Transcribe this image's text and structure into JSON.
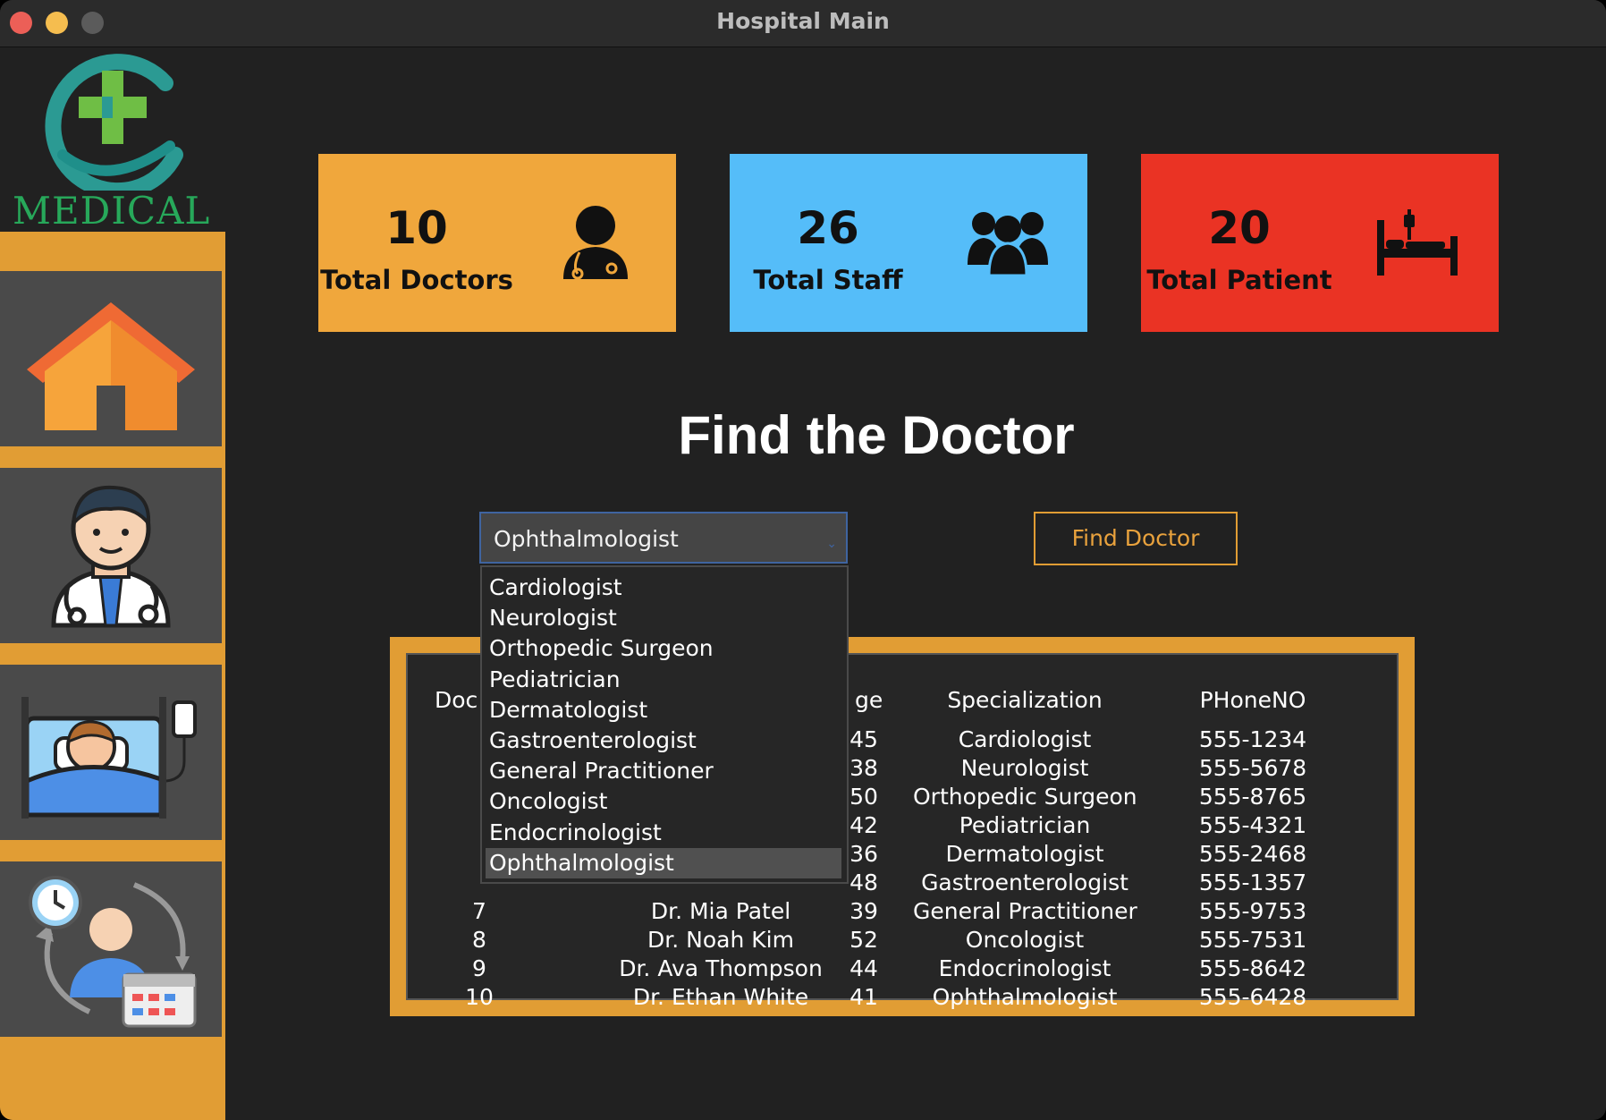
{
  "window": {
    "title": "Hospital Main"
  },
  "logo": {
    "text": "MEDICAL"
  },
  "colors": {
    "doctors_card": "#f0a73c",
    "staff_card": "#55bdf9",
    "patient_card": "#ea3324",
    "accent": "#e19d34"
  },
  "stats": [
    {
      "value": "10",
      "label": "Total Doctors",
      "icon": "doctor-icon"
    },
    {
      "value": "26",
      "label": "Total Staff",
      "icon": "staff-group-icon"
    },
    {
      "value": "20",
      "label": "Total Patient",
      "icon": "hospital-bed-icon"
    }
  ],
  "sidebar": {
    "items": [
      {
        "icon": "home-icon"
      },
      {
        "icon": "doctor-icon"
      },
      {
        "icon": "patient-bed-icon"
      },
      {
        "icon": "appointment-icon"
      }
    ]
  },
  "search": {
    "heading": "Find the Doctor",
    "selected": "Ophthalmologist",
    "options": [
      "Cardiologist",
      "Neurologist",
      "Orthopedic Surgeon",
      "Pediatrician",
      "Dermatologist",
      "Gastroenterologist",
      "General Practitioner",
      "Oncologist",
      "Endocrinologist",
      "Ophthalmologist"
    ],
    "button_label": "Find Doctor"
  },
  "table": {
    "headers": [
      "Doc",
      "ge",
      "Specialization",
      "PHoneNO"
    ],
    "rows": [
      {
        "id": "",
        "name": "",
        "age": "45",
        "spec": "Cardiologist",
        "phone": "555-1234"
      },
      {
        "id": "",
        "name": "",
        "age": "38",
        "spec": "Neurologist",
        "phone": "555-5678"
      },
      {
        "id": "",
        "name": "",
        "age": "50",
        "spec": "Orthopedic Surgeon",
        "phone": "555-8765"
      },
      {
        "id": "",
        "name": "",
        "age": "42",
        "spec": "Pediatrician",
        "phone": "555-4321"
      },
      {
        "id": "",
        "name": "",
        "age": "36",
        "spec": "Dermatologist",
        "phone": "555-2468"
      },
      {
        "id": "",
        "name": "",
        "age": "48",
        "spec": "Gastroenterologist",
        "phone": "555-1357"
      },
      {
        "id": "7",
        "name": "Dr. Mia Patel",
        "age": "39",
        "spec": "General Practitioner",
        "phone": "555-9753"
      },
      {
        "id": "8",
        "name": "Dr. Noah Kim",
        "age": "52",
        "spec": "Oncologist",
        "phone": "555-7531"
      },
      {
        "id": "9",
        "name": "Dr. Ava Thompson",
        "age": "44",
        "spec": "Endocrinologist",
        "phone": "555-8642"
      },
      {
        "id": "10",
        "name": "Dr. Ethan White",
        "age": "41",
        "spec": "Ophthalmologist",
        "phone": "555-6428"
      }
    ]
  }
}
